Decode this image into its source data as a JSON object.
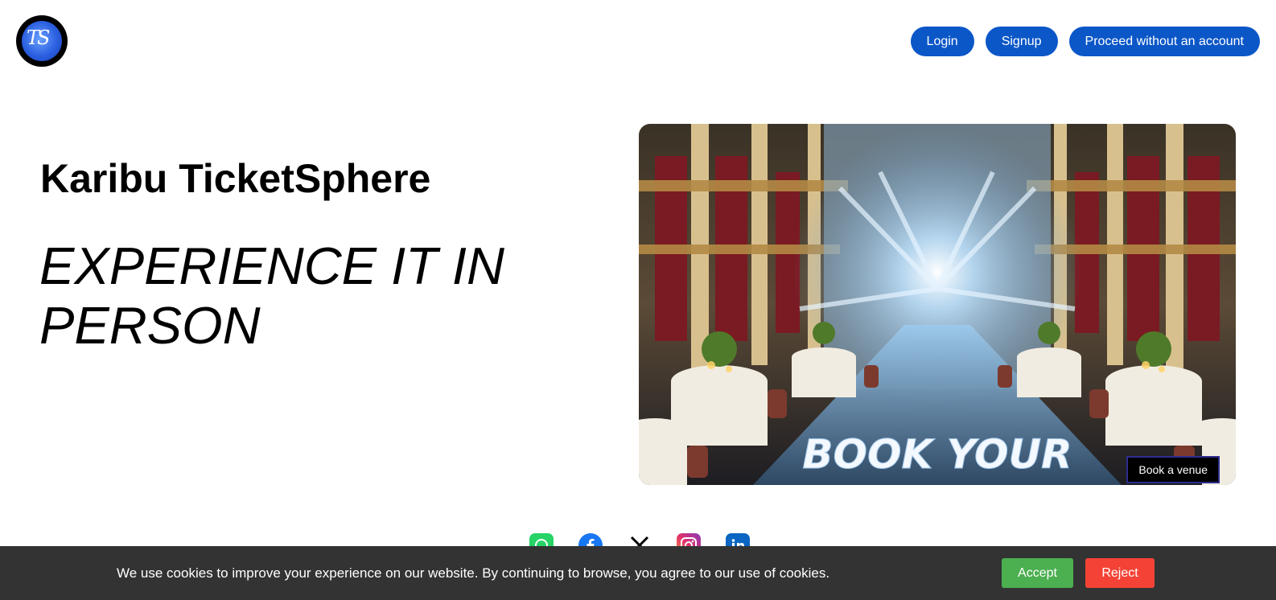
{
  "header": {
    "logo_text": "TS",
    "nav": [
      "Login",
      "Signup",
      "Proceed without an account"
    ]
  },
  "hero": {
    "title": "Karibu TicketSphere",
    "tagline": "EXPERIENCE IT IN PERSON",
    "image_text": "BOOK YOUR",
    "book_button": "Book a venue"
  },
  "social": {
    "icons": [
      "whatsapp-icon",
      "facebook-icon",
      "x-icon",
      "instagram-icon",
      "linkedin-icon"
    ]
  },
  "cookie": {
    "message": "We use cookies to improve your experience on our website. By continuing to browse, you agree to our use of cookies.",
    "accept_label": "Accept",
    "reject_label": "Reject"
  },
  "colors": {
    "primary_blue": "#0b57c8",
    "banner_bg": "#333333",
    "accept_green": "#4caf50",
    "reject_red": "#f44336"
  }
}
